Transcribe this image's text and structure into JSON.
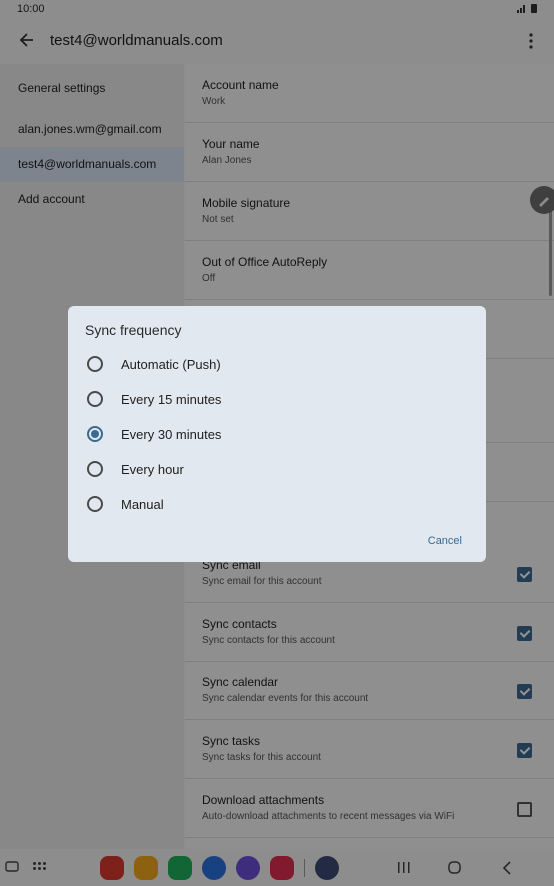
{
  "status": {
    "time": "10:00"
  },
  "header": {
    "title": "test4@worldmanuals.com"
  },
  "sidebar": {
    "items": [
      {
        "label": "General settings"
      },
      {
        "label": "alan.jones.wm@gmail.com"
      },
      {
        "label": "test4@worldmanuals.com"
      },
      {
        "label": "Add account"
      }
    ]
  },
  "settings": [
    {
      "title": "Account name",
      "sub": "Work"
    },
    {
      "title": "Your name",
      "sub": "Alan Jones"
    },
    {
      "title": "Mobile signature",
      "sub": "Not set"
    },
    {
      "title": "Out of Office AutoReply",
      "sub": "Off"
    },
    {
      "title": "Sync email",
      "sub": "Sync email for this account",
      "checked": true
    },
    {
      "title": "Sync contacts",
      "sub": "Sync contacts for this account",
      "checked": true
    },
    {
      "title": "Sync calendar",
      "sub": "Sync calendar events for this account",
      "checked": true
    },
    {
      "title": "Sync tasks",
      "sub": "Sync tasks for this account",
      "checked": true
    },
    {
      "title": "Download attachments",
      "sub": "Auto-download attachments to recent messages via WiFi",
      "checked": false
    }
  ],
  "dialog": {
    "title": "Sync frequency",
    "options": [
      {
        "label": "Automatic (Push)",
        "selected": false
      },
      {
        "label": "Every 15 minutes",
        "selected": false
      },
      {
        "label": "Every 30 minutes",
        "selected": true
      },
      {
        "label": "Every hour",
        "selected": false
      },
      {
        "label": "Manual",
        "selected": false
      }
    ],
    "cancel": "Cancel"
  },
  "colors": {
    "accent": "#3b6a8f",
    "selected_bg": "#d7e3f4"
  },
  "navbar": {
    "apps": [
      "flipboard-icon",
      "files-icon",
      "phone-icon",
      "messages-icon",
      "internet-icon",
      "camera-icon",
      "settings-icon"
    ]
  }
}
